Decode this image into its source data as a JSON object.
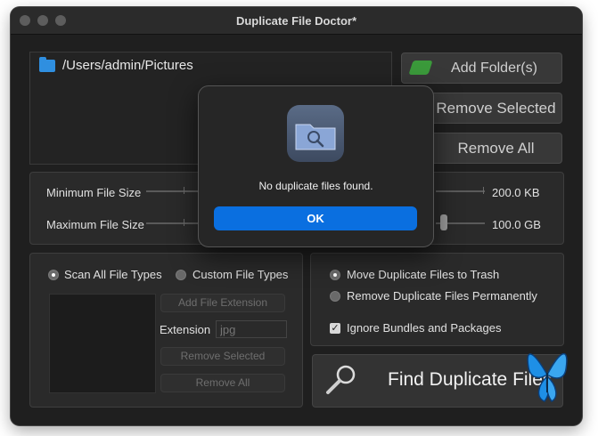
{
  "window": {
    "title": "Duplicate File Doctor*"
  },
  "folders": {
    "items": [
      "/Users/admin/Pictures"
    ]
  },
  "buttons": {
    "add_folders": "Add Folder(s)",
    "remove_selected": "Remove Selected",
    "remove_all": "Remove All"
  },
  "sizes": {
    "min_label": "Minimum File Size",
    "min_value": "200.0 KB",
    "max_label": "Maximum File Size",
    "max_value": "100.0 GB"
  },
  "file_types": {
    "scan_all": "Scan All File Types",
    "custom": "Custom File Types",
    "add_extension": "Add File Extension",
    "extension_label": "Extension",
    "extension_placeholder": "jpg",
    "remove_selected": "Remove Selected",
    "remove_all": "Remove All"
  },
  "options": {
    "move_trash": "Move Duplicate Files to Trash",
    "remove_permanently": "Remove Duplicate Files Permanently",
    "ignore_bundles": "Ignore Bundles and Packages"
  },
  "find": {
    "label": "Find Duplicate Files"
  },
  "dialog": {
    "message": "No duplicate files found.",
    "ok": "OK"
  },
  "colors": {
    "accent": "#0a6fe0",
    "folder": "#2f8fe0"
  }
}
